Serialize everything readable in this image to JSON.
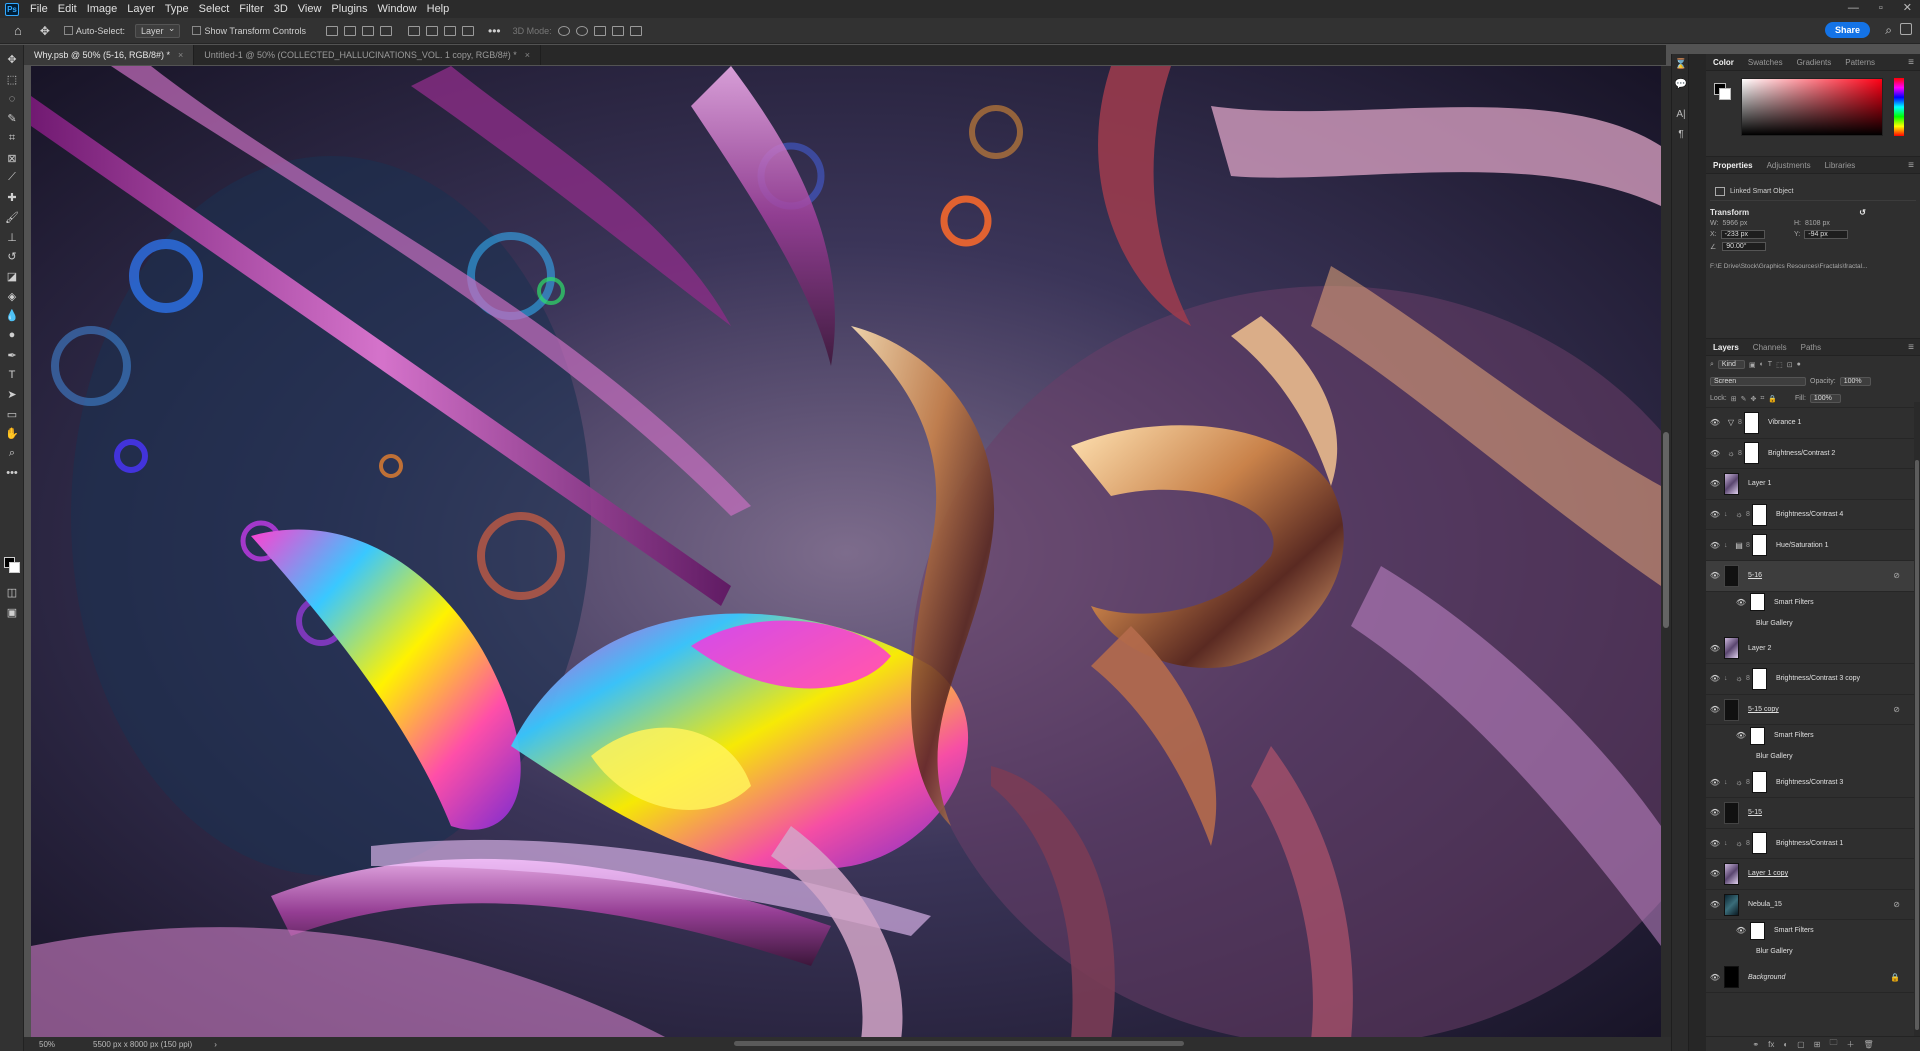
{
  "menubar": {
    "logo": "Ps",
    "items": [
      "File",
      "Edit",
      "Image",
      "Layer",
      "Type",
      "Select",
      "Filter",
      "3D",
      "View",
      "Plugins",
      "Window",
      "Help"
    ],
    "window_controls": [
      "—",
      "▫",
      "✕"
    ]
  },
  "options": {
    "auto_select_label": "Auto-Select:",
    "auto_select_value": "Layer",
    "transform_controls_label": "Show Transform Controls",
    "mode_label": "3D Mode:",
    "share_label": "Share"
  },
  "tabs": [
    {
      "label": "Why.psb @ 50% (5-16, RGB/8#) *",
      "close": "×"
    },
    {
      "label": "Untitled-1 @ 50% (COLLECTED_HALLUCINATIONS_VOL. 1 copy, RGB/8#) *",
      "close": "×"
    }
  ],
  "status": {
    "zoom": "50%",
    "doc_size": "5500 px x 8000 px (150 ppi)"
  },
  "color_panel": {
    "tabs": [
      "Color",
      "Swatches",
      "Gradients",
      "Patterns"
    ],
    "hue_color": "#ff0015"
  },
  "properties": {
    "tabs": [
      "Properties",
      "Adjustments",
      "Libraries"
    ],
    "object_type": "Linked Smart Object",
    "transform_label": "Transform",
    "w_label": "W:",
    "w_value": "5966 px",
    "h_label": "H:",
    "h_value": "8108 px",
    "x_label": "X:",
    "x_value": "-233 px",
    "y_label": "Y:",
    "y_value": "-94 px",
    "angle_value": "90.00°",
    "path": "F:\\E Drive\\Stock\\Graphics Resources\\Fractals\\fractal..."
  },
  "layers_panel": {
    "tabs": [
      "Layers",
      "Channels",
      "Paths"
    ],
    "filter_kind": "Kind",
    "blend_mode": "Screen",
    "opacity_label": "Opacity:",
    "opacity_value": "100%",
    "lock_label": "Lock:",
    "fill_label": "Fill:",
    "fill_value": "100%",
    "layers": [
      {
        "name": "Vibrance 1",
        "icon": "▽"
      },
      {
        "name": "Brightness/Contrast 2",
        "icon": "☼"
      },
      {
        "name": "Layer 1",
        "icon": ""
      },
      {
        "name": "Brightness/Contrast 4",
        "icon": "☼"
      },
      {
        "name": "Hue/Saturation 1",
        "icon": "▤"
      },
      {
        "name": "5-16",
        "icon": ""
      },
      {
        "name": "Smart Filters",
        "icon": ""
      },
      {
        "name": "Blur Gallery",
        "icon": ""
      },
      {
        "name": "Layer 2",
        "icon": ""
      },
      {
        "name": "Brightness/Contrast 3 copy",
        "icon": "☼"
      },
      {
        "name": "5-15 copy",
        "icon": ""
      },
      {
        "name": "Smart Filters",
        "icon": ""
      },
      {
        "name": "Blur Gallery",
        "icon": ""
      },
      {
        "name": "Brightness/Contrast 3",
        "icon": "☼"
      },
      {
        "name": "5-15",
        "icon": ""
      },
      {
        "name": "Brightness/Contrast 1",
        "icon": "☼"
      },
      {
        "name": "Layer 1 copy",
        "icon": ""
      },
      {
        "name": "Nebula_15",
        "icon": ""
      },
      {
        "name": "Smart Filters",
        "icon": ""
      },
      {
        "name": "Blur Gallery",
        "icon": ""
      },
      {
        "name": "Background",
        "icon": ""
      }
    ],
    "bottom_icons": [
      "fx",
      "◐",
      "▢",
      "⊞",
      "🗀",
      "＋",
      "🗑"
    ]
  }
}
